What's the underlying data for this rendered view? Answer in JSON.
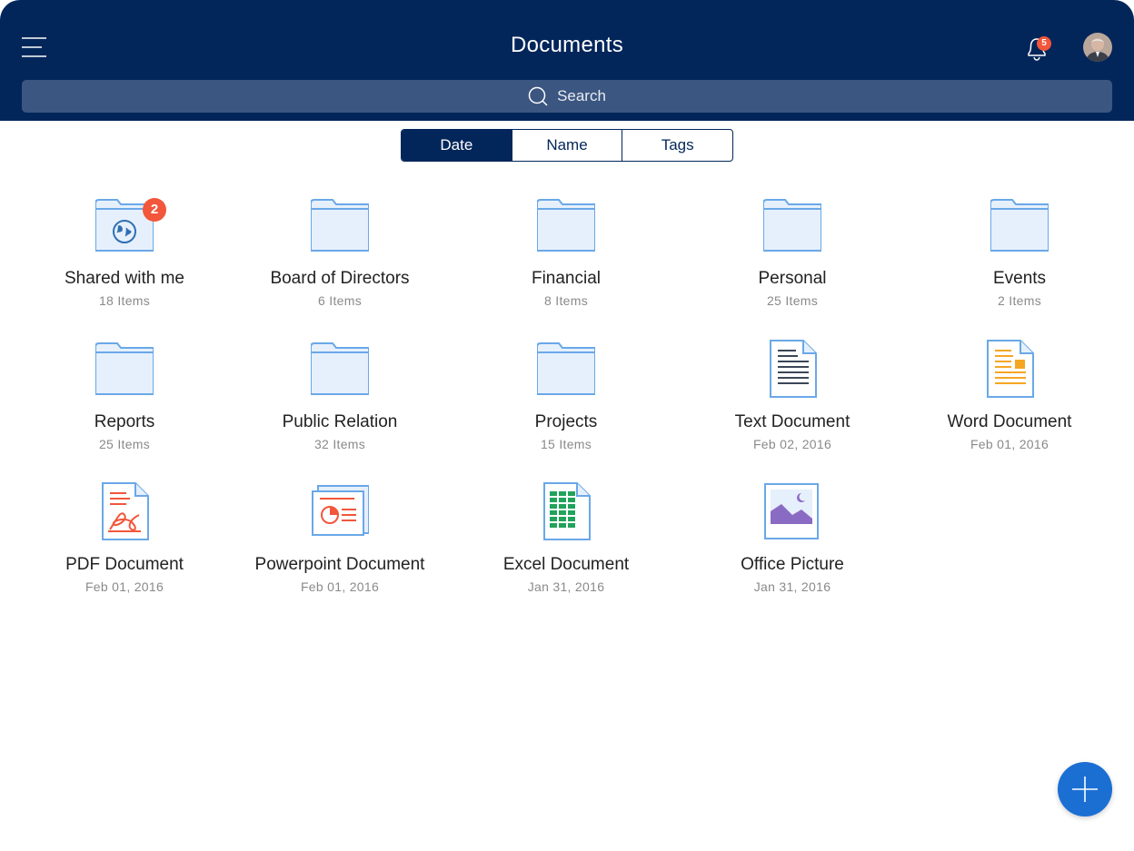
{
  "header": {
    "title": "Documents",
    "notification_count": "5",
    "search_placeholder": "Search",
    "accent_color": "#03265a"
  },
  "sort_tabs": [
    {
      "label": "Date",
      "active": true
    },
    {
      "label": "Name",
      "active": false
    },
    {
      "label": "Tags",
      "active": false
    }
  ],
  "items": [
    {
      "name": "Shared with me",
      "sub": "18 Items",
      "icon": "shared-folder-icon",
      "badge": "2"
    },
    {
      "name": "Board of Directors",
      "sub": "6 Items",
      "icon": "folder-icon"
    },
    {
      "name": "Financial",
      "sub": "8 Items",
      "icon": "folder-icon"
    },
    {
      "name": "Personal",
      "sub": "25 Items",
      "icon": "folder-icon"
    },
    {
      "name": "Events",
      "sub": "2 Items",
      "icon": "folder-icon"
    },
    {
      "name": "Reports",
      "sub": "25 Items",
      "icon": "folder-icon"
    },
    {
      "name": "Public Relation",
      "sub": "32 Items",
      "icon": "folder-icon"
    },
    {
      "name": "Projects",
      "sub": "15 Items",
      "icon": "folder-icon"
    },
    {
      "name": "Text Document",
      "sub": "Feb 02, 2016",
      "icon": "text-document-icon"
    },
    {
      "name": "Word Document",
      "sub": "Feb 01, 2016",
      "icon": "word-document-icon"
    },
    {
      "name": "PDF Document",
      "sub": "Feb 01, 2016",
      "icon": "pdf-document-icon"
    },
    {
      "name": "Powerpoint Document",
      "sub": "Feb 01, 2016",
      "icon": "powerpoint-document-icon"
    },
    {
      "name": "Excel Document",
      "sub": "Jan 31, 2016",
      "icon": "excel-document-icon"
    },
    {
      "name": "Office Picture",
      "sub": "Jan 31, 2016",
      "icon": "picture-icon"
    }
  ],
  "fab": {
    "icon": "plus-icon",
    "color": "#1b6fd3"
  }
}
